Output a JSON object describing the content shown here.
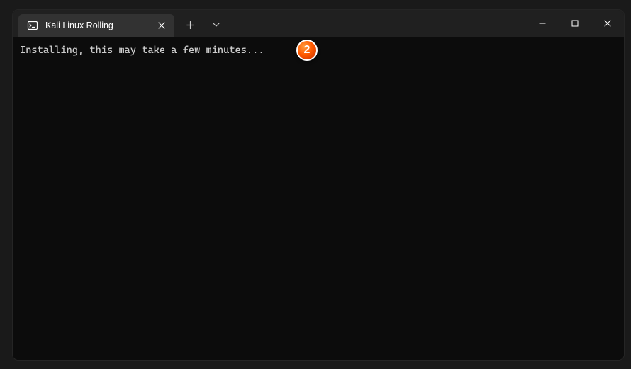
{
  "titlebar": {
    "tab": {
      "title": "Kali Linux Rolling"
    }
  },
  "terminal": {
    "line1": "Installing, this may take a few minutes..."
  },
  "annotation": {
    "badge_number": "2"
  }
}
